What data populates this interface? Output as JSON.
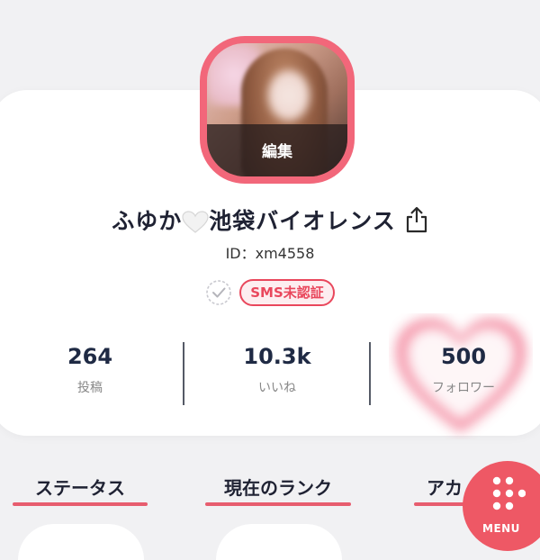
{
  "profile": {
    "avatar_edit_label": "編集",
    "name_part1": "ふゆか",
    "name_part2": "池袋バイオレンス",
    "user_id": "ID：xm4558",
    "sms_badge": "SMS未認証"
  },
  "stats": [
    {
      "value": "264",
      "label": "投稿"
    },
    {
      "value": "10.3k",
      "label": "いいね"
    },
    {
      "value": "500",
      "label": "フォロワー"
    }
  ],
  "tabs": [
    {
      "label": "ステータス"
    },
    {
      "label": "現在のランク"
    },
    {
      "label": "アカ"
    }
  ],
  "menu": {
    "label": "MENU"
  },
  "icons": {
    "share": "share-icon",
    "verify": "check-circle-icon",
    "heart": "white-heart-icon",
    "menu": "grid-dots-icon"
  },
  "colors": {
    "accent": "#ee5865",
    "badge_red": "#e9475c",
    "background": "#f1f1f3"
  }
}
